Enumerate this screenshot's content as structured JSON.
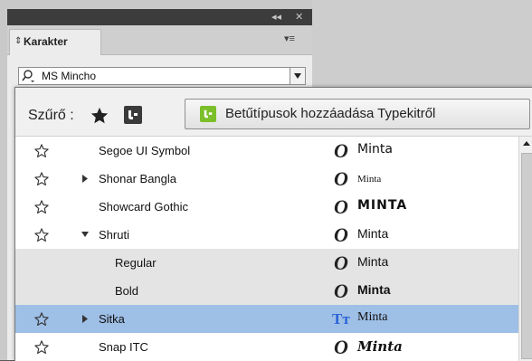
{
  "panel": {
    "tab_label": "Karakter",
    "font_family_value": "MS Mincho"
  },
  "filter": {
    "label": "Szűrő :",
    "typekit_button_label": "Betűtípusok hozzáadása Typekitről"
  },
  "fonts": [
    {
      "name": "Segoe UI Symbol",
      "sample": "Minta",
      "toggle": "none",
      "type": "opentype",
      "level": 0,
      "selected": false
    },
    {
      "name": "Shonar Bangla",
      "sample": "Minta",
      "toggle": "collapsed",
      "type": "opentype",
      "level": 0,
      "selected": false
    },
    {
      "name": "Showcard Gothic",
      "sample": "MINTA",
      "toggle": "none",
      "type": "opentype",
      "level": 0,
      "selected": false
    },
    {
      "name": "Shruti",
      "sample": "Minta",
      "toggle": "expanded",
      "type": "opentype",
      "level": 0,
      "selected": false
    },
    {
      "name": "Regular",
      "sample": "Minta",
      "toggle": "none",
      "type": "opentype",
      "level": 1,
      "selected": false
    },
    {
      "name": "Bold",
      "sample": "Minta",
      "toggle": "none",
      "type": "opentype",
      "level": 1,
      "selected": false
    },
    {
      "name": "Sitka",
      "sample": "Minta",
      "toggle": "collapsed",
      "type": "truetype",
      "level": 0,
      "selected": true
    },
    {
      "name": "Snap ITC",
      "sample": "Minta",
      "toggle": "none",
      "type": "opentype",
      "level": 0,
      "selected": false
    }
  ],
  "colors": {
    "selected_row": "#9ebfe6",
    "sub_row": "#e4e4e4",
    "typekit_green": "#7bbf2a",
    "truetype_blue": "#2a63d8"
  },
  "icons": {
    "opentype": "opentype-o-icon",
    "truetype": "truetype-tt-icon",
    "favorite": "star-outline-icon"
  }
}
